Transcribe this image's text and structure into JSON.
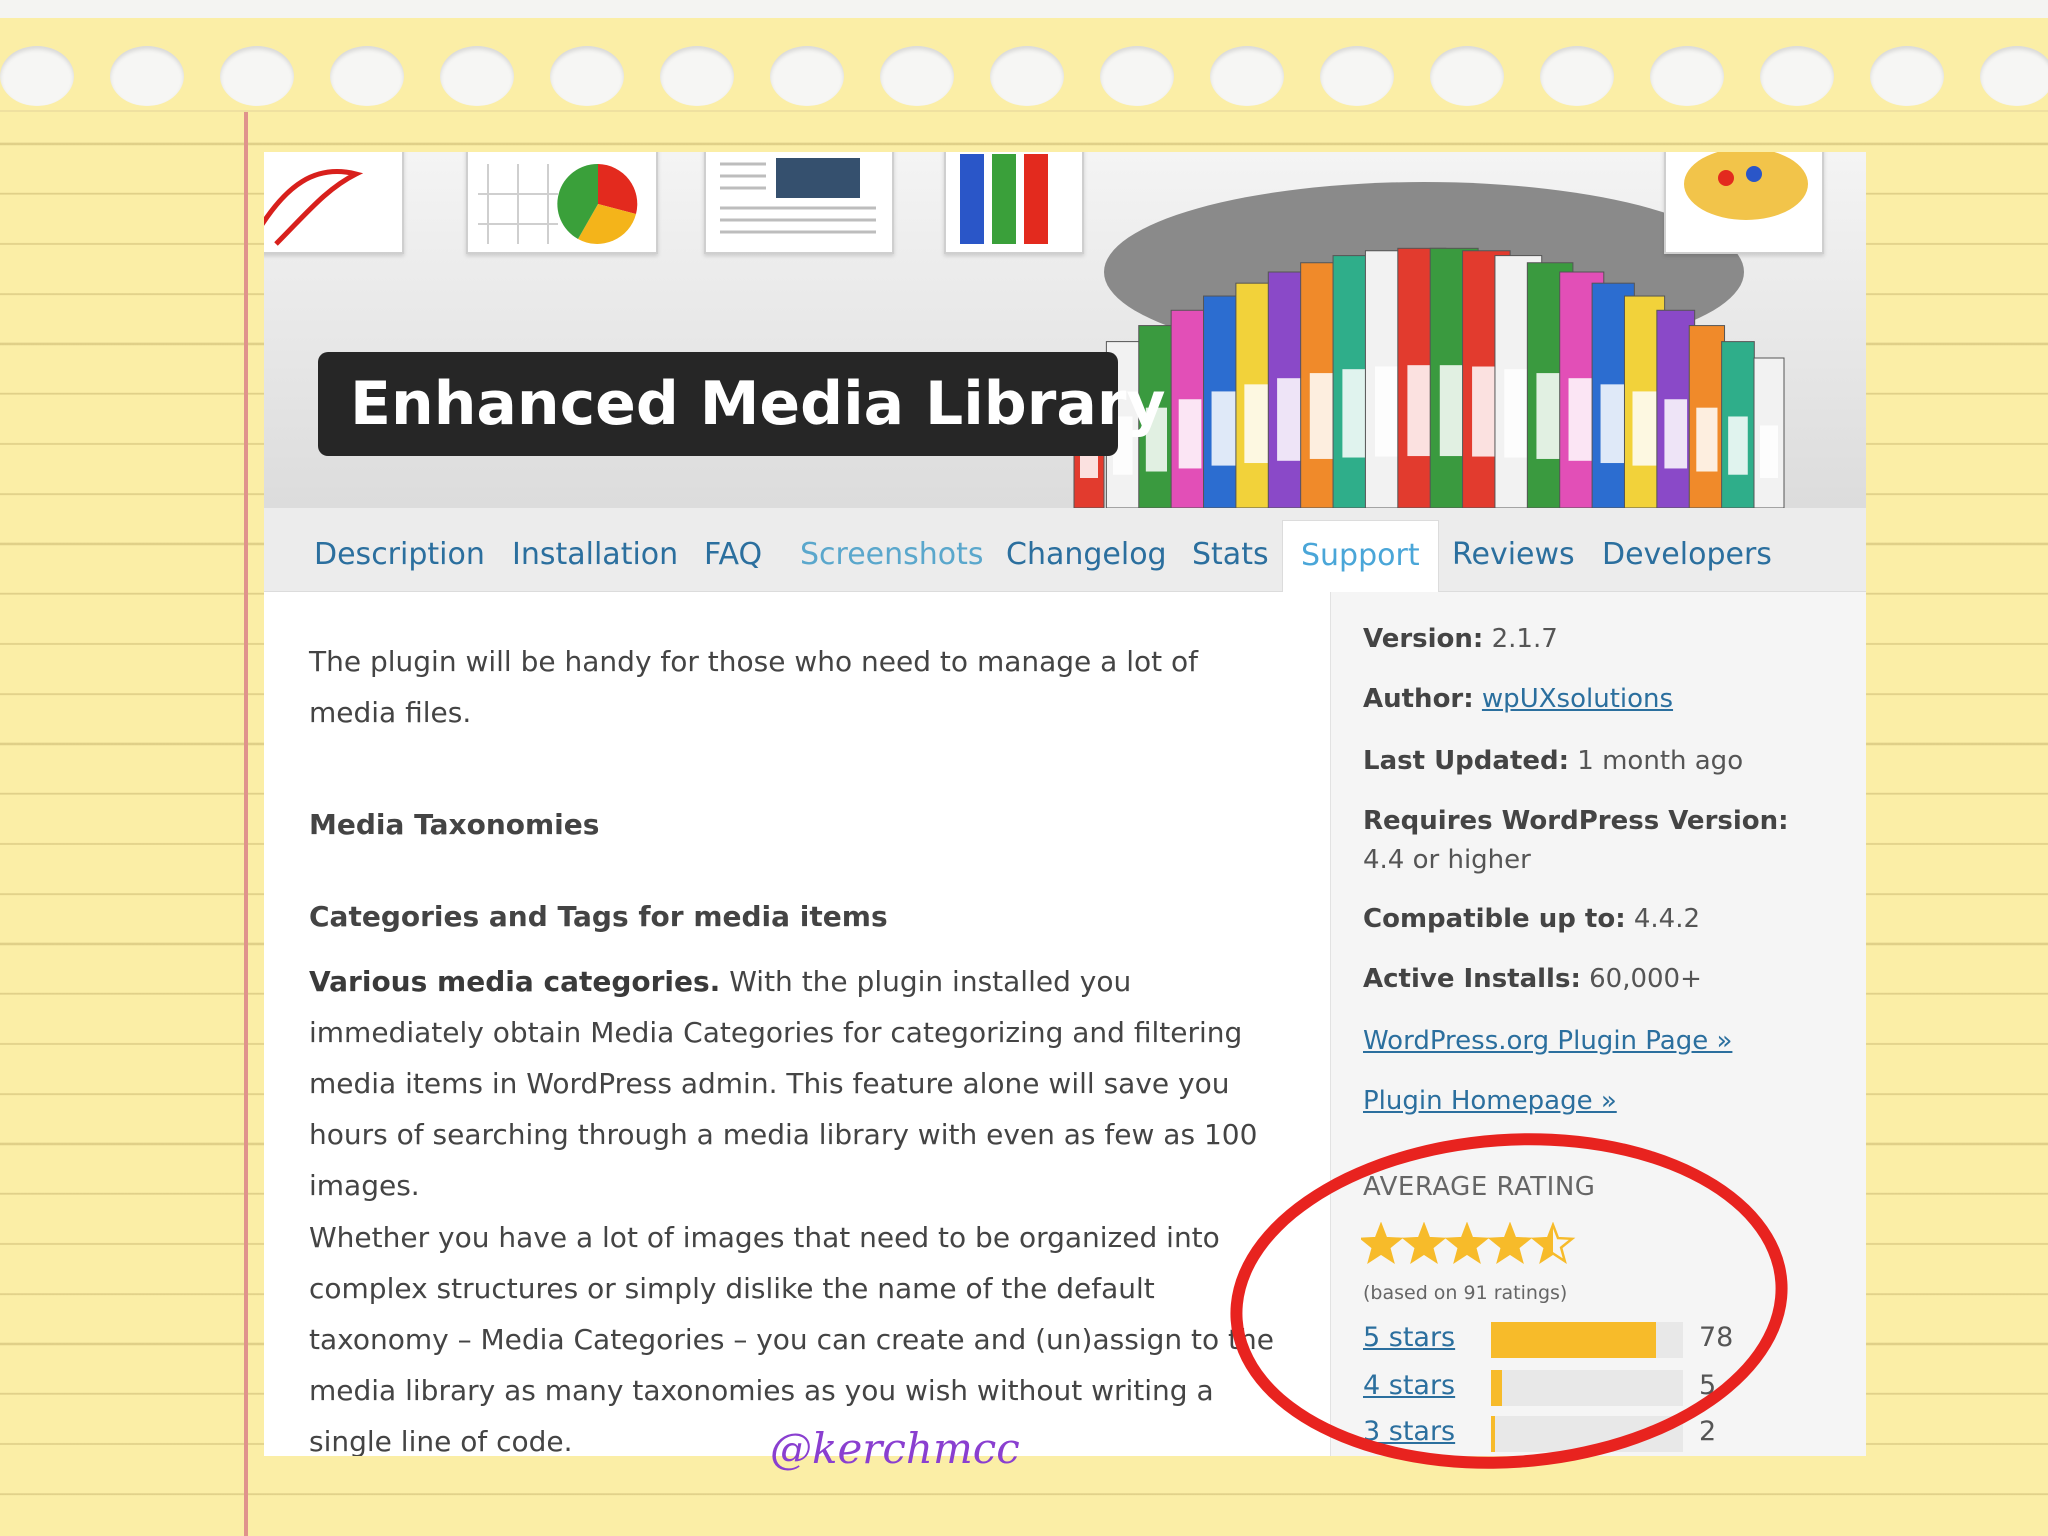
{
  "plugin": {
    "title": "Enhanced Media Library"
  },
  "tabs": [
    {
      "label": "Description"
    },
    {
      "label": "Installation"
    },
    {
      "label": "FAQ"
    },
    {
      "label": "Screenshots"
    },
    {
      "label": "Changelog"
    },
    {
      "label": "Stats"
    },
    {
      "label": "Support"
    },
    {
      "label": "Reviews"
    },
    {
      "label": "Developers"
    }
  ],
  "active_tab": "Support",
  "description": {
    "intro": "The plugin will be handy for those who need to manage a lot of media files.",
    "heading1": "Media Taxonomies",
    "heading2": "Categories and Tags for media items",
    "para1_bold": "Various media categories.",
    "para1_text": " With the plugin installed you immediately obtain Media Categories for categorizing and filtering media items in WordPress admin. This feature alone will save you hours of searching through a media library with even as few as 100 images.",
    "para2": "Whether you have a lot of images that need to be organized into complex structures or simply dislike the name of the default taxonomy – Media Categories – you can create and (un)assign to the media library as many taxonomies as you wish without writing a single line of code."
  },
  "sidebar": {
    "version_label": "Version:",
    "version_value": " 2.1.7",
    "author_label": "Author:",
    "author_value": "wpUXsolutions",
    "updated_label": "Last Updated:",
    "updated_value": " 1 month ago",
    "requires_label": "Requires WordPress Version:",
    "requires_value": " 4.4 or higher",
    "compatible_label": "Compatible up to:",
    "compatible_value": " 4.4.2",
    "installs_label": "Active Installs:",
    "installs_value": " 60,000+",
    "link_plugin_page": "WordPress.org Plugin Page »",
    "link_homepage": "Plugin Homepage »"
  },
  "rating": {
    "title": "AVERAGE RATING",
    "stars_value": 4.5,
    "stars_max": 5,
    "based_on": "(based on 91 ratings)",
    "rows": [
      {
        "label": "5 stars",
        "count": "78",
        "fraction": 0.857
      },
      {
        "label": "4 stars",
        "count": "5",
        "fraction": 0.055
      },
      {
        "label": "3 stars",
        "count": "2",
        "fraction": 0.022
      }
    ]
  },
  "watermark": "@kerchmcc",
  "colors": {
    "paper": "#fbeea6",
    "link": "#2b6f9e",
    "star": "#f7bb2a",
    "highlight": "#e8231f",
    "watermark": "#8a3fd0"
  }
}
